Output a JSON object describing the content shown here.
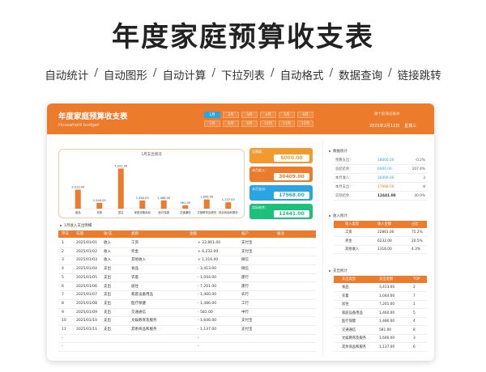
{
  "hero": {
    "title": "年度家庭预算收支表",
    "features": [
      "自动统计",
      "自动图形",
      "自动计算",
      "下拉列表",
      "自动格式",
      "数据查询",
      "链接跳转"
    ],
    "separator": "/"
  },
  "colors": {
    "accent": "#ec7b2c",
    "blue": "#2ba4e3",
    "green": "#1cc07a",
    "month_active": "#2ba4e3"
  },
  "header": {
    "title": "年度家庭预算收支表",
    "subtitle": "Household budget",
    "months": [
      "1月",
      "2月",
      "3月",
      "4月",
      "5月",
      "6月",
      "7月",
      "8月",
      "9月",
      "10月",
      "11月",
      "12月"
    ],
    "active_month": "1月",
    "right_top": "做个航海记账本",
    "date": "2025年2月12日",
    "weekday": "星期三"
  },
  "chart_data": {
    "type": "bar",
    "title": "1月支出情况",
    "categories": [
      "食品",
      "衣着",
      "居住",
      "家庭设备用品",
      "医疗保健",
      "交通通信",
      "文娱教育及服务",
      "其余商品和服务"
    ],
    "values": [
      3413.0,
      1044.0,
      7201.0,
      1460.0,
      1486.0,
      581.0,
      1646.0,
      1137.0
    ],
    "value_labels": [
      "3,413.00",
      "1,044.00",
      "7,201.00",
      "1,460.00",
      "1,486.00",
      "581.00",
      "1,646.00",
      "1,137.00"
    ],
    "ylim": [
      0,
      8000
    ],
    "color": "#ec7b2c"
  },
  "kpis": [
    {
      "label": "总预算：",
      "value": "6000.00",
      "color": "#f29a2e"
    },
    {
      "label": "本月收入：",
      "value": "30409.00",
      "color": "#ec7b2c"
    },
    {
      "label": "本月支出：",
      "value": "17968.00",
      "color": "#2ba4e3"
    },
    {
      "label": "实际结余：",
      "value": "12441.00",
      "color": "#1cc07a"
    }
  ],
  "detail": {
    "section_label": "1月收入支出明细",
    "columns": [
      "序号",
      "日期",
      "收/支",
      "类别",
      "金额",
      "账户",
      "备注"
    ],
    "rows": [
      {
        "no": "1",
        "date": "2025/01/01",
        "type": "收入",
        "cat": "工资",
        "amt": "+ 22,861.00",
        "acct": "支付宝",
        "note": ""
      },
      {
        "no": "2",
        "date": "2025/01/02",
        "type": "收入",
        "cat": "奖金",
        "amt": "+ 6,232.00",
        "acct": "支付宝",
        "note": ""
      },
      {
        "no": "3",
        "date": "2025/01/03",
        "type": "收入",
        "cat": "其他收入",
        "amt": "+ 1,316.00",
        "acct": "微信",
        "note": ""
      },
      {
        "no": "4",
        "date": "2025/01/04",
        "type": "支出",
        "cat": "食品",
        "amt": "- 3,413.00",
        "acct": "微信",
        "note": ""
      },
      {
        "no": "5",
        "date": "2025/01/05",
        "type": "支出",
        "cat": "衣着",
        "amt": "- 1,044.00",
        "acct": "建行",
        "note": ""
      },
      {
        "no": "6",
        "date": "2025/01/06",
        "type": "支出",
        "cat": "居住",
        "amt": "- 7,201.00",
        "acct": "建行",
        "note": ""
      },
      {
        "no": "7",
        "date": "2025/01/07",
        "type": "支出",
        "cat": "家庭设备用品",
        "amt": "- 1,460.00",
        "acct": "农行",
        "note": ""
      },
      {
        "no": "8",
        "date": "2025/01/08",
        "type": "支出",
        "cat": "医疗保健",
        "amt": "- 1,486.00",
        "acct": "工行",
        "note": ""
      },
      {
        "no": "9",
        "date": "2025/01/09",
        "type": "支出",
        "cat": "交通通信",
        "amt": "- 581.00",
        "acct": "中行",
        "note": ""
      },
      {
        "no": "10",
        "date": "2025/01/10",
        "type": "支出",
        "cat": "文娱教育及服务",
        "amt": "- 1,646.00",
        "acct": "支付宝",
        "note": ""
      },
      {
        "no": "11",
        "date": "2025/01/11",
        "type": "支出",
        "cat": "其余商品和服务",
        "amt": "- 1,137.00",
        "acct": "支付宝",
        "note": ""
      },
      {
        "no": "-",
        "date": "",
        "type": "",
        "cat": "",
        "amt": "-",
        "acct": "",
        "note": ""
      },
      {
        "no": "-",
        "date": "",
        "type": "",
        "cat": "",
        "amt": "-",
        "acct": "",
        "note": ""
      }
    ]
  },
  "stats": {
    "section_label": "数据统计",
    "rows": [
      {
        "label": "预算支出：",
        "value": "18000.00",
        "change": "-0.2%",
        "color": "#2ba4e3"
      },
      {
        "label": "总结结余：",
        "value": "6000.00",
        "change": "207.4%",
        "color": "#2ba4e3"
      },
      {
        "label": "本月收入：",
        "value": "30409.00",
        "change": "3",
        "color": "#2ba4e3"
      },
      {
        "label": "本月支出：",
        "value": "17968.00",
        "change": "8",
        "color": "#ec7b2c"
      },
      {
        "label": "实际结余：",
        "value": "12441.00",
        "change": "40.9%",
        "color": "#333333"
      }
    ]
  },
  "income": {
    "section_label": "收入统计",
    "columns": [
      "收入类型",
      "收入金额",
      "占比"
    ],
    "rows": [
      {
        "type": "工资",
        "amt": "22861.00",
        "pct": "75.2%"
      },
      {
        "type": "奖金",
        "amt": "6232.00",
        "pct": "20.5%"
      },
      {
        "type": "其他收入",
        "amt": "1316.00",
        "pct": "4.3%"
      }
    ]
  },
  "expense": {
    "section_label": "支出统计",
    "columns": [
      "支出类型",
      "支出金额",
      "TOP"
    ],
    "rows": [
      {
        "type": "食品",
        "amt": "3,413.00",
        "top": "2"
      },
      {
        "type": "衣着",
        "amt": "1,044.00",
        "top": "7"
      },
      {
        "type": "居住",
        "amt": "7,201.00",
        "top": "1"
      },
      {
        "type": "家庭设备用品",
        "amt": "1,460.00",
        "top": "5"
      },
      {
        "type": "医疗保健",
        "amt": "1,486.00",
        "top": "4"
      },
      {
        "type": "交通通信",
        "amt": "581.00",
        "top": "8"
      },
      {
        "type": "文娱教育及服务",
        "amt": "1,646.00",
        "top": "3"
      },
      {
        "type": "其余商品和服务",
        "amt": "1,137.00",
        "top": "6"
      }
    ]
  }
}
